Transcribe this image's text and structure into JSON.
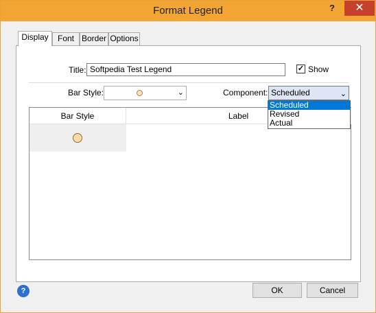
{
  "window": {
    "title": "Format Legend",
    "help_glyph": "?",
    "close_glyph": "✕",
    "accent": "#f3a533"
  },
  "tabs": [
    {
      "label": "Display"
    },
    {
      "label": "Font"
    },
    {
      "label": "Border"
    },
    {
      "label": "Options"
    }
  ],
  "display": {
    "title_label": "Title:",
    "title_value": "Softpedia Test Legend",
    "show_label": "Show",
    "show_checked": true,
    "bar_style_label": "Bar Style:",
    "component_label": "Component:",
    "component_value": "Scheduled",
    "component_options": [
      "Scheduled",
      "Revised",
      "Actual"
    ]
  },
  "grid": {
    "columns": [
      "Bar Style",
      "Label"
    ]
  },
  "footer": {
    "ok_label": "OK",
    "cancel_label": "Cancel"
  },
  "icons": [
    "help-icon",
    "close-icon",
    "chevron-down-icon",
    "checkbox-icon",
    "circle-bar-style-icon"
  ],
  "colors": {
    "selection": "#0078d7",
    "titlebar": "#f3a533"
  }
}
